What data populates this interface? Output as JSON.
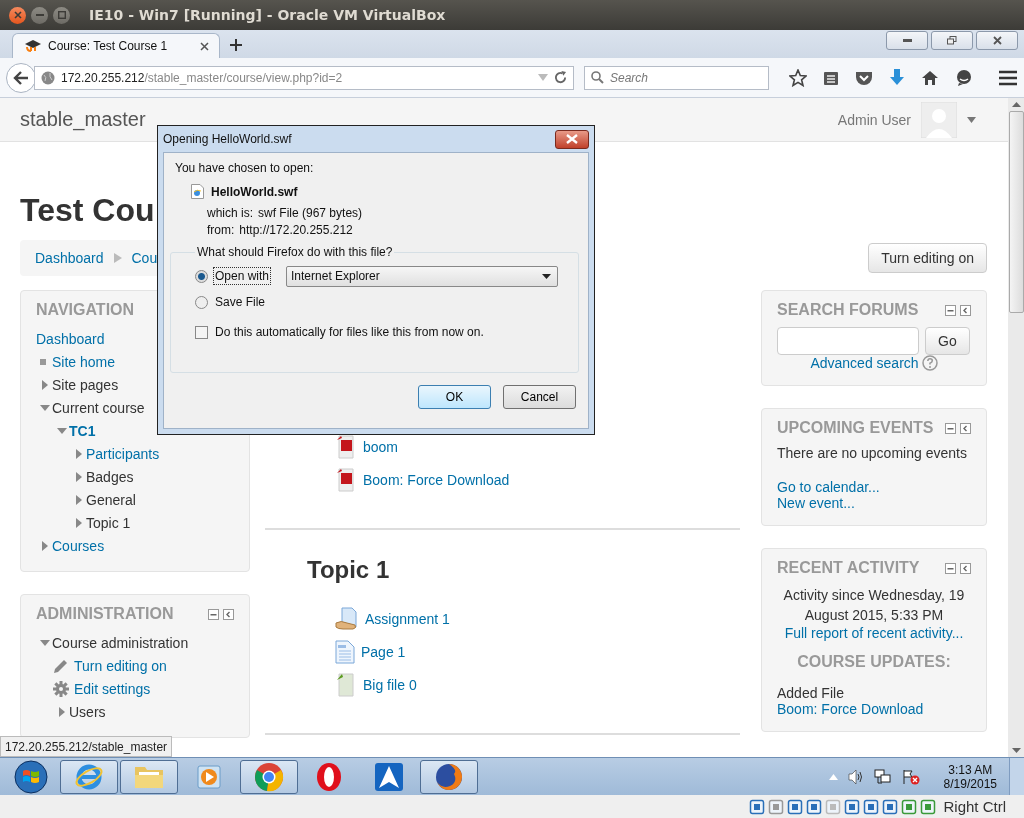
{
  "window": {
    "title": "IE10 - Win7 [Running] - Oracle VM VirtualBox"
  },
  "browser": {
    "tabs": [
      {
        "label": "Course: Test Course 1",
        "selected": true
      }
    ],
    "url_host": "172.20.255.212",
    "url_path": "/stable_master/course/view.php?id=2",
    "search_placeholder": "Search"
  },
  "site": {
    "name": "stable_master",
    "user": "Admin User"
  },
  "course": {
    "heading": "Test Cou",
    "breadcrumb": [
      "Dashboard",
      "Cou"
    ],
    "edit_button": "Turn editing on"
  },
  "navigation": {
    "title": "NAVIGATION",
    "items": [
      {
        "label": "Dashboard",
        "kind": "plain",
        "link": true,
        "current": false
      },
      {
        "label": "Site home",
        "kind": "leaf",
        "link": true,
        "current": false
      },
      {
        "label": "Site pages",
        "kind": "branch",
        "link": false,
        "current": false,
        "expanded": false
      },
      {
        "label": "Current course",
        "kind": "branch",
        "link": false,
        "current": false,
        "expanded": true,
        "children": [
          {
            "label": "TC1",
            "kind": "branch",
            "link": true,
            "current": true,
            "expanded": true,
            "children": [
              {
                "label": "Participants",
                "kind": "branch",
                "link": true,
                "current": false,
                "expanded": false
              },
              {
                "label": "Badges",
                "kind": "branch",
                "link": false,
                "current": false,
                "expanded": false
              },
              {
                "label": "General",
                "kind": "branch",
                "link": false,
                "current": false,
                "expanded": false
              },
              {
                "label": "Topic 1",
                "kind": "branch",
                "link": false,
                "current": false,
                "expanded": false
              }
            ]
          }
        ]
      },
      {
        "label": "Courses",
        "kind": "branch",
        "link": true,
        "current": false,
        "expanded": false
      }
    ]
  },
  "administration": {
    "title": "ADMINISTRATION",
    "items": [
      {
        "label": "Course administration",
        "kind": "branch",
        "link": false,
        "current": false,
        "expanded": true,
        "children": [
          {
            "label": "Turn editing on",
            "kind": "pencil",
            "link": true,
            "current": false
          },
          {
            "label": "Edit settings",
            "kind": "gear",
            "link": true,
            "current": false
          },
          {
            "label": "Users",
            "kind": "branch",
            "link": false,
            "current": false,
            "expanded": false
          }
        ]
      }
    ]
  },
  "sections": [
    {
      "activities": [
        {
          "label": "boom",
          "kind": "flash"
        },
        {
          "label": "Boom: Force Download",
          "kind": "flash"
        }
      ]
    },
    {
      "heading": "Topic 1",
      "activities": [
        {
          "label": "Assignment 1",
          "kind": "assign"
        },
        {
          "label": "Page 1",
          "kind": "page"
        },
        {
          "label": "Big file 0",
          "kind": "file"
        }
      ]
    }
  ],
  "search_forums": {
    "title": "SEARCH FORUMS",
    "button": "Go",
    "advanced": "Advanced search"
  },
  "upcoming_events": {
    "title": "UPCOMING EVENTS",
    "message": "There are no upcoming events",
    "links": [
      "Go to calendar...",
      "New event..."
    ]
  },
  "recent_activity": {
    "title": "RECENT ACTIVITY",
    "since": "Activity since Wednesday, 19 August 2015, 5:33 PM",
    "report": "Full report of recent activity...",
    "updates_title": "COURSE UPDATES:",
    "update_label": "Added File",
    "update_link": "Boom: Force Download"
  },
  "status_tooltip": "172.20.255.212/stable_master",
  "dialog": {
    "title": "Opening HelloWorld.swf",
    "intro": "You have chosen to open:",
    "filename": "HelloWorld.swf",
    "which_label": "which is:",
    "which_value": "swf File (967 bytes)",
    "from_label": "from:",
    "from_value": "http://172.20.255.212",
    "question": "What should Firefox do with this file?",
    "options": [
      {
        "label": "Open with",
        "selected": true
      },
      {
        "label": "Save File",
        "selected": false
      }
    ],
    "application": "Internet Explorer",
    "auto": {
      "label": "Do this automatically for files like this from now on.",
      "checked": false
    },
    "buttons": [
      "OK",
      "Cancel"
    ]
  },
  "taskbar": {
    "apps": [
      {
        "kind": "ie",
        "running": true
      },
      {
        "kind": "folder",
        "running": true
      },
      {
        "kind": "media",
        "running": false
      },
      {
        "kind": "chrome",
        "running": true
      },
      {
        "kind": "opera",
        "running": false
      },
      {
        "kind": "atext",
        "running": false
      },
      {
        "kind": "firefox",
        "running": true
      }
    ],
    "time": "3:13 AM",
    "date": "8/19/2015"
  },
  "vbox": {
    "host_key": "Right Ctrl"
  }
}
